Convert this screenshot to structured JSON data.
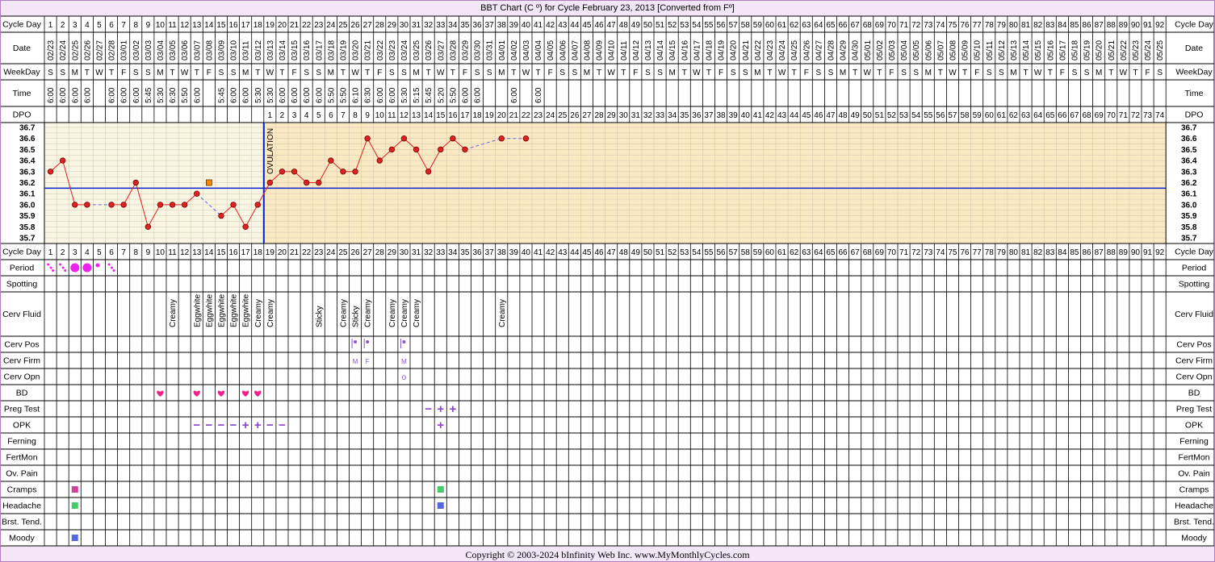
{
  "title": "BBT Chart (C º) for Cycle February 23, 2013  [Converted from Fº]",
  "copyright": "Copyright © 2003-2024 bInfinity Web Inc.    www.MyMonthlyCycles.com",
  "labels": {
    "cycle_day": "Cycle Day",
    "date": "Date",
    "weekday": "WeekDay",
    "time": "Time",
    "dpo": "DPO",
    "period": "Period",
    "spotting": "Spotting",
    "cerv_fluid": "Cerv Fluid",
    "cerv_pos": "Cerv Pos",
    "cerv_firm": "Cerv Firm",
    "cerv_opn": "Cerv Opn",
    "bd": "BD",
    "preg_test": "Preg Test",
    "opk": "OPK",
    "ferning": "Ferning",
    "fertmon": "FertMon",
    "ov_pain": "Ov. Pain",
    "cramps": "Cramps",
    "headache": "Headache",
    "brst_tend": "Brst. Tend.",
    "moody": "Moody"
  },
  "ovulation_label": "OVULATION",
  "colors": {
    "pre_bg": "#faf6e4",
    "post_bg": "#fbe9c4",
    "grid": "#cfc7b0",
    "coverline": "#0022cc",
    "ovulation": "#0022cc",
    "dot": "#dd2222",
    "line": "#dd2222",
    "dash": "#6666dd",
    "period": "#ee22ee",
    "bd": "#ee2288",
    "test": "#8844cc"
  },
  "dates": [
    "02/23",
    "02/24",
    "02/25",
    "02/26",
    "02/27",
    "02/28",
    "03/01",
    "03/02",
    "03/03",
    "03/04",
    "03/05",
    "03/06",
    "03/07",
    "03/08",
    "03/09",
    "03/10",
    "03/11",
    "03/12",
    "03/13",
    "03/14",
    "03/15",
    "03/16",
    "03/17",
    "03/18",
    "03/19",
    "03/20",
    "03/21",
    "03/22",
    "03/23",
    "03/24",
    "03/25",
    "03/26",
    "03/27",
    "03/28",
    "03/29",
    "03/30",
    "03/31",
    "04/01",
    "04/02",
    "04/03",
    "04/04",
    "04/05",
    "04/06",
    "04/07",
    "04/08",
    "04/09",
    "04/10",
    "04/11",
    "04/12",
    "04/13",
    "04/14",
    "04/15",
    "04/16",
    "04/17",
    "04/18",
    "04/19",
    "04/20",
    "04/21",
    "04/22",
    "04/23",
    "04/24",
    "04/25",
    "04/26",
    "04/27",
    "04/28",
    "04/29",
    "04/30",
    "05/01",
    "05/02",
    "05/03",
    "05/04",
    "05/05",
    "05/06",
    "05/07",
    "05/08",
    "05/09",
    "05/10",
    "05/11",
    "05/12",
    "05/13",
    "05/14",
    "05/15",
    "05/16",
    "05/17",
    "05/18",
    "05/19",
    "05/20",
    "05/21",
    "05/22",
    "05/23",
    "05/24",
    "05/25"
  ],
  "weekdays": [
    "S",
    "S",
    "M",
    "T",
    "W",
    "T",
    "F",
    "S",
    "S",
    "M",
    "T",
    "W",
    "T",
    "F",
    "S",
    "S",
    "M",
    "T",
    "W",
    "T",
    "F",
    "S",
    "S",
    "M",
    "T",
    "W",
    "T",
    "F",
    "S",
    "S",
    "M",
    "T",
    "W",
    "T",
    "F",
    "S",
    "S",
    "M",
    "T",
    "W",
    "T",
    "F",
    "S",
    "S",
    "M",
    "T",
    "W",
    "T",
    "F",
    "S",
    "S",
    "M",
    "T",
    "W",
    "T",
    "F",
    "S",
    "S",
    "M",
    "T",
    "W",
    "T",
    "F",
    "S",
    "S",
    "M",
    "T",
    "W",
    "T",
    "F",
    "S",
    "S",
    "M",
    "T",
    "W",
    "T",
    "F",
    "S",
    "S",
    "M",
    "T",
    "W",
    "T",
    "F",
    "S",
    "S",
    "M",
    "T",
    "W",
    "T",
    "F",
    "S"
  ],
  "times": [
    "6:00",
    "6:00",
    "6:00",
    "6:00",
    "",
    "6:00",
    "6:00",
    "6:00",
    "5:45",
    "5:30",
    "6:30",
    "5:50",
    "6:00",
    "",
    "5:45",
    "6:00",
    "6:00",
    "5:30",
    "5:30",
    "6:00",
    "6:00",
    "6:00",
    "6:00",
    "5:50",
    "5:50",
    "6:10",
    "6:30",
    "6:00",
    "6:00",
    "5:30",
    "5:15",
    "5:45",
    "5:20",
    "5:50",
    "6:00",
    "6:00",
    "",
    "",
    "6:00",
    "",
    "6:00"
  ],
  "dpo_start_day": 19,
  "dpo_count": 74,
  "chart_data": {
    "type": "line",
    "title": "BBT Chart (C º) for Cycle February 23, 2013  [Converted from Fº]",
    "xlabel": "Cycle Day",
    "ylabel": "",
    "ylim": [
      35.7,
      36.7
    ],
    "yticks": [
      "36.7",
      "36.6",
      "36.5",
      "36.4",
      "36.3",
      "36.2",
      "36.1",
      "36.0",
      "35.9",
      "35.8",
      "35.7"
    ],
    "coverline": 36.15,
    "ovulation_day": 18,
    "points": [
      {
        "day": 1,
        "temp": 36.3
      },
      {
        "day": 2,
        "temp": 36.4
      },
      {
        "day": 3,
        "temp": 36.0
      },
      {
        "day": 4,
        "temp": 36.0
      },
      {
        "day": 6,
        "temp": 36.0
      },
      {
        "day": 7,
        "temp": 36.0
      },
      {
        "day": 8,
        "temp": 36.2
      },
      {
        "day": 9,
        "temp": 35.8
      },
      {
        "day": 10,
        "temp": 36.0
      },
      {
        "day": 11,
        "temp": 36.0
      },
      {
        "day": 12,
        "temp": 36.0
      },
      {
        "day": 13,
        "temp": 36.1
      },
      {
        "day": 15,
        "temp": 35.9
      },
      {
        "day": 16,
        "temp": 36.0
      },
      {
        "day": 17,
        "temp": 35.8
      },
      {
        "day": 18,
        "temp": 36.0
      },
      {
        "day": 19,
        "temp": 36.2
      },
      {
        "day": 20,
        "temp": 36.3
      },
      {
        "day": 21,
        "temp": 36.3
      },
      {
        "day": 22,
        "temp": 36.2
      },
      {
        "day": 23,
        "temp": 36.2
      },
      {
        "day": 24,
        "temp": 36.4
      },
      {
        "day": 25,
        "temp": 36.3
      },
      {
        "day": 26,
        "temp": 36.3
      },
      {
        "day": 27,
        "temp": 36.6
      },
      {
        "day": 28,
        "temp": 36.4
      },
      {
        "day": 29,
        "temp": 36.5
      },
      {
        "day": 30,
        "temp": 36.6
      },
      {
        "day": 31,
        "temp": 36.5
      },
      {
        "day": 32,
        "temp": 36.3
      },
      {
        "day": 33,
        "temp": 36.5
      },
      {
        "day": 34,
        "temp": 36.6
      },
      {
        "day": 35,
        "temp": 36.5
      },
      {
        "day": 38,
        "temp": 36.6
      },
      {
        "day": 40,
        "temp": 36.6
      }
    ],
    "discarded_points": [
      {
        "day": 14,
        "temp": 36.2
      }
    ]
  },
  "period": {
    "1": "spot",
    "2": "spot",
    "3": "heavy",
    "4": "heavy",
    "5": "light",
    "6": "spot"
  },
  "cerv_fluid": {
    "11": "Creamy",
    "13": "Eggwhite",
    "14": "Eggwhite",
    "15": "Eggwhite",
    "16": "Eggwhite",
    "17": "Eggwhite",
    "18": "Creamy",
    "19": "Creamy",
    "23": "Sticky",
    "25": "Creamy",
    "26": "Sticky",
    "27": "Creamy",
    "29": "Creamy",
    "30": "Creamy",
    "31": "Creamy",
    "38": "Creamy"
  },
  "cerv_pos": [
    "26",
    "27",
    "30"
  ],
  "cerv_firm": {
    "26": "M",
    "27": "F",
    "30": "M"
  },
  "cerv_opn": {
    "30": "o"
  },
  "bd_days": [
    "10",
    "13",
    "15",
    "17",
    "18"
  ],
  "preg_test": {
    "32": "−",
    "33": "+",
    "34": "+"
  },
  "opk": {
    "13": "−",
    "14": "−",
    "15": "−",
    "16": "−",
    "17": "+",
    "18": "+",
    "19": "−",
    "20": "−",
    "33": "+"
  },
  "cramps": {
    "3": "#cc4499",
    "33": "#44cc66"
  },
  "headache": {
    "3": "#44cc66",
    "33": "#5566dd"
  },
  "moody": {
    "3": "#5566dd"
  }
}
